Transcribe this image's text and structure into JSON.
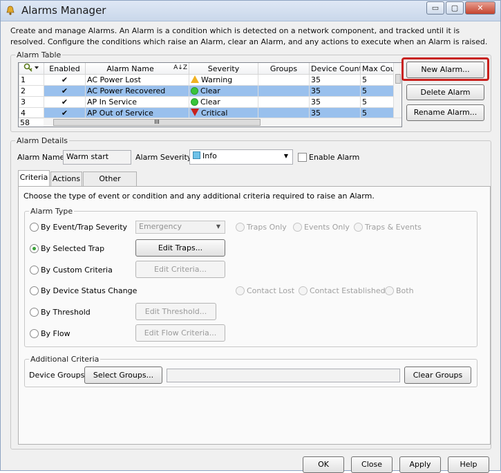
{
  "window": {
    "title": "Alarms Manager",
    "controls": {
      "minimize": "▭",
      "maximize": "▢",
      "close": "✕"
    }
  },
  "description": "Create and manage Alarms. An Alarm is a condition which is detected on a network component, and tracked until it is resolved. Configure the conditions which raise an Alarm, clear an Alarm, and any actions to execute when an Alarm is raised.",
  "alarm_table": {
    "legend": "Alarm Table",
    "columns": [
      "",
      "Enabled",
      "Alarm Name",
      "Severity",
      "Groups",
      "Device Count",
      "Max Cou"
    ],
    "rows": [
      {
        "num": "1",
        "enabled": "✔",
        "name": "AC Power Lost",
        "severity": "Warning",
        "groups": "",
        "device_count": "35",
        "max_count": "5"
      },
      {
        "num": "2",
        "enabled": "✔",
        "name": "AC Power Recovered",
        "severity": "Clear",
        "groups": "",
        "device_count": "35",
        "max_count": "5"
      },
      {
        "num": "3",
        "enabled": "✔",
        "name": "AP In Service",
        "severity": "Clear",
        "groups": "",
        "device_count": "35",
        "max_count": "5"
      },
      {
        "num": "4",
        "enabled": "✔",
        "name": "AP Out of Service",
        "severity": "Critical",
        "groups": "",
        "device_count": "35",
        "max_count": "5"
      }
    ],
    "row_count": "58",
    "scroll_thumb": "III",
    "buttons": {
      "new": "New Alarm...",
      "delete": "Delete Alarm",
      "rename": "Rename Alarm..."
    }
  },
  "details": {
    "legend": "Alarm Details",
    "name_label": "Alarm Name:",
    "name_value": "Warm start",
    "severity_label": "Alarm Severity:",
    "severity_value": "Info",
    "enable_label": "Enable Alarm",
    "tabs": [
      "Criteria",
      "Actions",
      "Other Options"
    ],
    "criteria_desc": "Choose the type of event or condition and any additional criteria required to raise an Alarm.",
    "alarm_type_legend": "Alarm Type",
    "types": {
      "event_trap": "By Event/Trap Severity",
      "selected_trap": "By Selected Trap",
      "custom": "By Custom Criteria",
      "device_status": "By Device Status Change",
      "threshold": "By Threshold",
      "flow": "By Flow"
    },
    "severity_select": "Emergency",
    "trap_options": [
      "Traps Only",
      "Events Only",
      "Traps & Events"
    ],
    "status_options": [
      "Contact Lost",
      "Contact Established",
      "Both"
    ],
    "edit_buttons": {
      "traps": "Edit Traps...",
      "criteria": "Edit Criteria...",
      "threshold": "Edit Threshold...",
      "flow": "Edit Flow Criteria..."
    },
    "additional_legend": "Additional Criteria",
    "device_groups_label": "Device Groups:",
    "select_groups": "Select Groups...",
    "clear_groups": "Clear Groups"
  },
  "footer": {
    "ok": "OK",
    "close": "Close",
    "apply": "Apply",
    "help": "Help"
  },
  "colors": {
    "selection": "#99c0ed",
    "highlight_ring": "#c8201c",
    "info_swatch": "#6fc2e8"
  }
}
